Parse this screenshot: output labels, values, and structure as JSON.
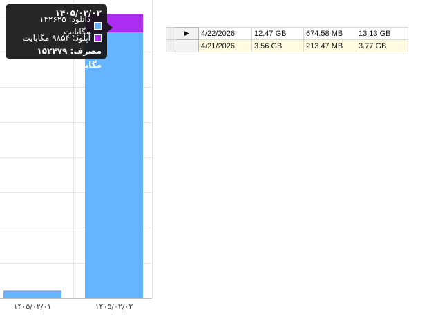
{
  "chart_data": {
    "type": "bar",
    "stacked": true,
    "categories": [
      "۱۴۰۵/۰۲/۰۱",
      "۱۴۰۵/۰۲/۰۲"
    ],
    "series": [
      {
        "name": "دانلود",
        "values": [
          3650,
          142625
        ],
        "color": "#64b5fd"
      },
      {
        "name": "آپلود",
        "values": [
          220,
          9854
        ],
        "color": "#ac2cf2"
      }
    ],
    "ylim": [
      0,
      160000
    ],
    "grid": true
  },
  "tooltip": {
    "title": "۱۴۰۵/۰۲/۰۲",
    "download": "دانلود: ۱۴۲۶۲۵ مگابایت",
    "upload": "آپلود: ۹۸۵۴ مگابایت",
    "total": "مصرف: ۱۵۲۴۷۹ مگابایت",
    "download_color": "#64b5fd",
    "upload_color": "#ac2cf2"
  },
  "table": {
    "rows": [
      {
        "selected": true,
        "date": "4/22/2026",
        "download": "12.47 GB",
        "upload": "674.58 MB",
        "total": "13.13 GB"
      },
      {
        "selected": false,
        "date": "4/21/2026",
        "download": "3.56 GB",
        "upload": "213.47 MB",
        "total": "3.77 GB"
      }
    ],
    "current_row_icon": "play-arrow-icon"
  }
}
